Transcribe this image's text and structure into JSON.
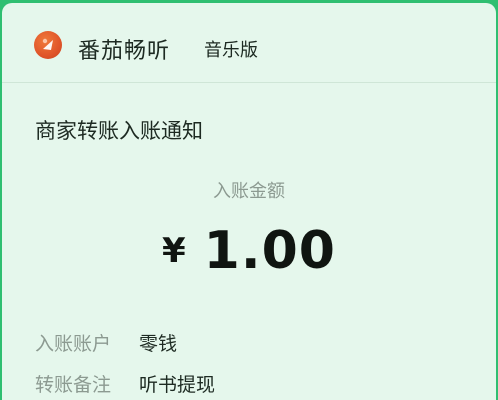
{
  "header": {
    "app_name": "番茄畅听",
    "app_edition": "音乐版"
  },
  "notice": {
    "title": "商家转账入账通知",
    "amount_label": "入账金额",
    "currency_symbol": "¥",
    "amount": "1.00"
  },
  "details": [
    {
      "label": "入账账户",
      "value": "零钱"
    },
    {
      "label": "转账备注",
      "value": "听书提现"
    }
  ],
  "colors": {
    "accent_green": "#2fbf71",
    "card_background": "#e5f7ec",
    "logo_orange": "#e0552a"
  },
  "icons": {
    "app_logo": "tomato-play-logo-icon"
  }
}
